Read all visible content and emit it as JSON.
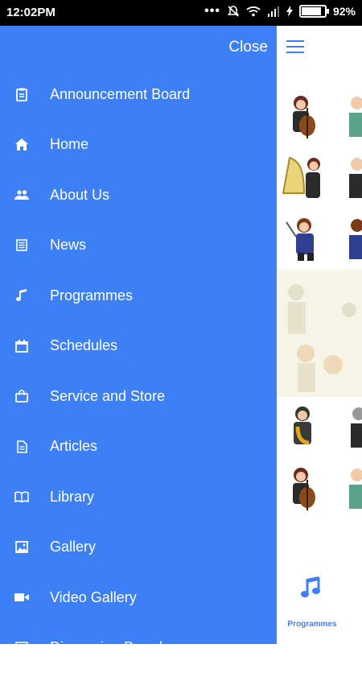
{
  "status": {
    "time": "12:02PM",
    "battery": "92%",
    "battery_level": 0.92
  },
  "drawer": {
    "close_label": "Close",
    "items": [
      {
        "label": "Announcement Board",
        "icon": "clipboard-icon"
      },
      {
        "label": "Home",
        "icon": "home-icon"
      },
      {
        "label": "About Us",
        "icon": "people-icon"
      },
      {
        "label": "News",
        "icon": "newspaper-icon"
      },
      {
        "label": "Programmes",
        "icon": "music-note-icon"
      },
      {
        "label": "Schedules",
        "icon": "calendar-icon"
      },
      {
        "label": "Service and Store",
        "icon": "shopping-bag-icon"
      },
      {
        "label": "Articles",
        "icon": "document-icon"
      },
      {
        "label": "Library",
        "icon": "book-icon"
      },
      {
        "label": "Gallery",
        "icon": "image-icon"
      },
      {
        "label": "Video Gallery",
        "icon": "video-icon"
      },
      {
        "label": "Discussion Board",
        "icon": "chat-icon"
      }
    ]
  },
  "main": {
    "bottom_tab": {
      "label": "Programmes",
      "icon": "music-note-icon"
    }
  },
  "colors": {
    "accent": "#3d7ff5"
  }
}
